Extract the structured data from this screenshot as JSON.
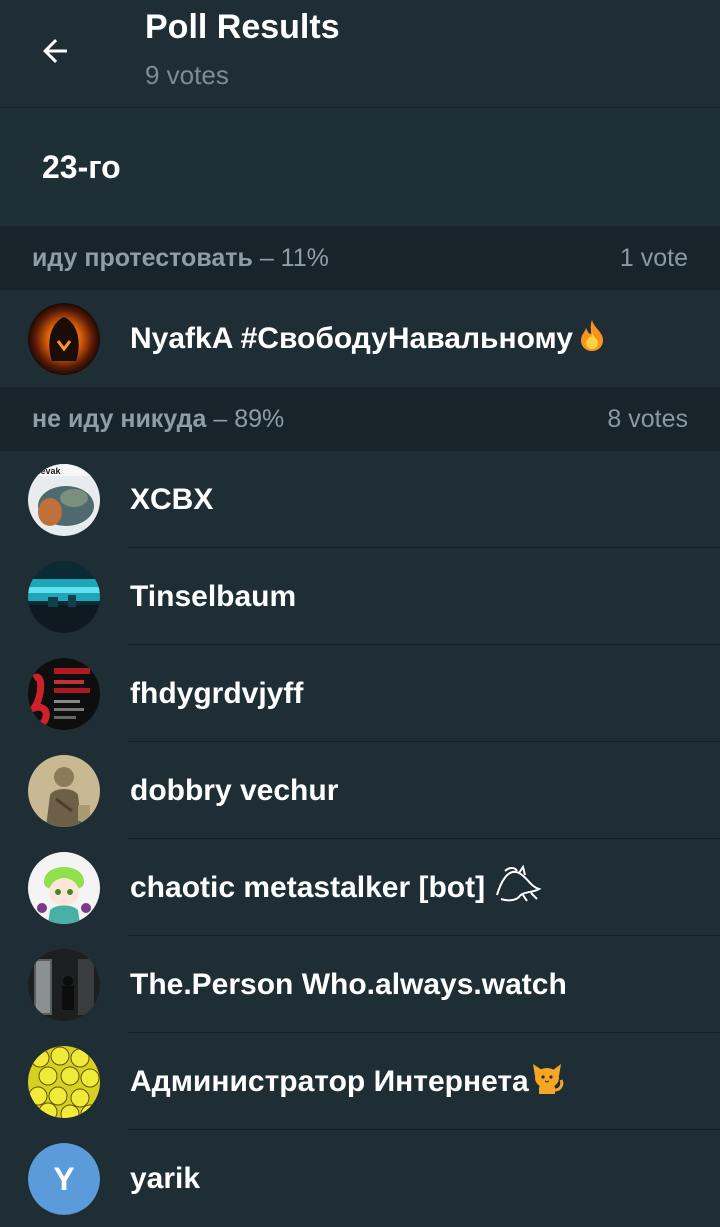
{
  "header": {
    "title": "Poll Results",
    "subtitle": "9 votes"
  },
  "question": "23-го",
  "options": [
    {
      "label": "иду протестовать",
      "percent": "– 11%",
      "votes": "1 vote",
      "voters": [
        {
          "name": "NyafkA #СвободуНавальному",
          "emoji": "fire"
        }
      ]
    },
    {
      "label": "не иду никуда",
      "percent": "– 89%",
      "votes": "8 votes",
      "voters": [
        {
          "name": "XCBX"
        },
        {
          "name": "Tinselbaum"
        },
        {
          "name": "fhdygrdvjyff"
        },
        {
          "name": "dobbry vechur"
        },
        {
          "name": "chaotic metastalker [bot]",
          "emoji": "dragon"
        },
        {
          "name": "The.Person Who.always.watch"
        },
        {
          "name": "Администратор Интернета",
          "emoji": "cat"
        },
        {
          "name": "yarik",
          "avatar_letter": "Y"
        }
      ]
    }
  ]
}
